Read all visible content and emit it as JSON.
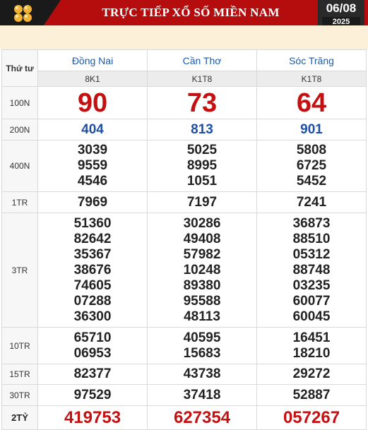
{
  "header": {
    "title": "TRỰC TIẾP XỔ SỐ MIỀN NAM",
    "date_day_month": "06/08",
    "date_year": "2025"
  },
  "weekday": "Thứ tư",
  "provinces": [
    {
      "name": "Đồng Nai",
      "code": "8K1"
    },
    {
      "name": "Cần Thơ",
      "code": "K1T8"
    },
    {
      "name": "Sóc Trăng",
      "code": "K1T8"
    }
  ],
  "prizes": [
    {
      "label": "100N",
      "values": [
        [
          "90"
        ],
        [
          "73"
        ],
        [
          "64"
        ]
      ]
    },
    {
      "label": "200N",
      "values": [
        [
          "404"
        ],
        [
          "813"
        ],
        [
          "901"
        ]
      ]
    },
    {
      "label": "400N",
      "values": [
        [
          "3039",
          "9559",
          "4546"
        ],
        [
          "5025",
          "8995",
          "1051"
        ],
        [
          "5808",
          "6725",
          "5452"
        ]
      ]
    },
    {
      "label": "1TR",
      "values": [
        [
          "7969"
        ],
        [
          "7197"
        ],
        [
          "7241"
        ]
      ]
    },
    {
      "label": "3TR",
      "values": [
        [
          "51360",
          "82642",
          "35367",
          "38676",
          "74605",
          "07288",
          "36300"
        ],
        [
          "30286",
          "49408",
          "57982",
          "10248",
          "89380",
          "95588",
          "48113"
        ],
        [
          "36873",
          "88510",
          "05312",
          "88748",
          "03235",
          "60077",
          "60045"
        ]
      ]
    },
    {
      "label": "10TR",
      "values": [
        [
          "65710",
          "06953"
        ],
        [
          "40595",
          "15683"
        ],
        [
          "16451",
          "18210"
        ]
      ]
    },
    {
      "label": "15TR",
      "values": [
        [
          "82377"
        ],
        [
          "43738"
        ],
        [
          "29272"
        ]
      ]
    },
    {
      "label": "30TR",
      "values": [
        [
          "97529"
        ],
        [
          "37418"
        ],
        [
          "52887"
        ]
      ]
    },
    {
      "label": "2TỶ",
      "values": [
        [
          "419753"
        ],
        [
          "627354"
        ],
        [
          "057267"
        ]
      ]
    }
  ],
  "colors": {
    "header_red": "#b50d0d",
    "prize_red": "#c41010",
    "province_blue": "#1e5aa8",
    "cream": "#fdf0d8"
  }
}
